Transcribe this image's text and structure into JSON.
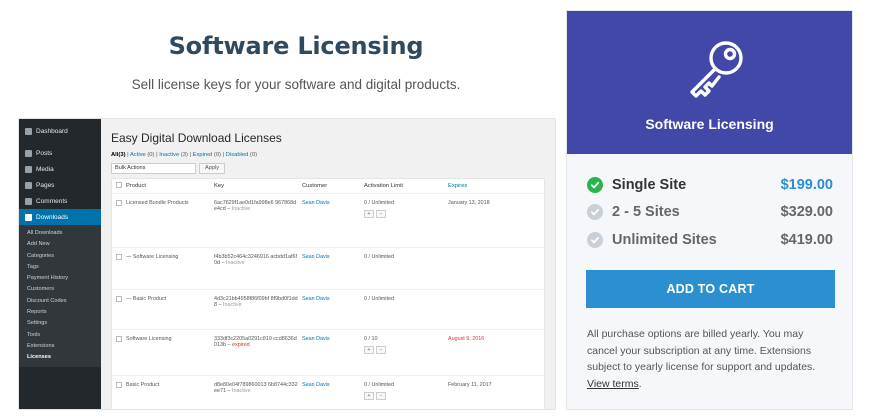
{
  "hero": {
    "title": "Software Licensing",
    "subtitle": "Sell license keys for your software and digital products."
  },
  "admin": {
    "sidebar_top": [
      "Dashboard",
      "Posts",
      "Media",
      "Pages",
      "Comments",
      "Downloads"
    ],
    "sidebar_sub": [
      "All Downloads",
      "Add New",
      "Categories",
      "Tags",
      "Payment History",
      "Customers",
      "Discount Codes",
      "Reports",
      "Settings",
      "Tools",
      "Extensions",
      "Licenses"
    ],
    "page_title": "Easy Digital Download Licenses",
    "filters": {
      "all": "All",
      "all_count": "(3)",
      "active": "Active",
      "active_count": "(0)",
      "inactive": "Inactive",
      "inactive_count": "(3)",
      "expired": "Expired",
      "expired_count": "(0)",
      "disabled": "Disabled",
      "disabled_count": "(0)"
    },
    "bulk_actions": "Bulk Actions",
    "apply": "Apply",
    "columns": [
      "Product",
      "Key",
      "Customer",
      "Activation Limit",
      "Expires"
    ],
    "rows": [
      {
        "product": "Licensed Bundle Products",
        "key": "6ac7629f1ae0d1fa998e6 967868de4cd",
        "status": "Inactive",
        "customer": "Sean Davis",
        "limit": "0 / Unlimited",
        "expires": "January 13, 2018",
        "has_buttons": true
      },
      {
        "product": "— Software Licensing",
        "key": "f4b3b52c464c3246916 acbdd1af6f0d",
        "status": "Inactive",
        "customer": "Sean Davis",
        "limit": "0 / Unlimited",
        "expires": "",
        "has_buttons": false
      },
      {
        "product": "— Basic Product",
        "key": "4d3c21bb4958f86f09bf 8f9bd0f1dd8",
        "status": "Inactive",
        "customer": "Sean Davis",
        "limit": "0 / Unlimited",
        "expires": "",
        "has_buttons": false
      },
      {
        "product": "Software Licensing",
        "key": "333df3c2205a0291c819 ccd8636d013b",
        "status": "expired",
        "customer": "Sean Davis",
        "limit": "0 / 10",
        "expires": "August 9, 2016",
        "has_buttons": true
      },
      {
        "product": "Basic Product",
        "key": "d8e80e04f789860013 6b8744c332ee71",
        "status": "Inactive",
        "customer": "Sean Davis",
        "limit": "0 / Unlimited",
        "expires": "February 11, 2017",
        "has_buttons": true
      }
    ]
  },
  "card": {
    "name": "Software Licensing",
    "header_color": "#4148a8",
    "options": [
      {
        "label": "Single Site",
        "price": "$199.00",
        "selected": true
      },
      {
        "label": "2 - 5 Sites",
        "price": "$329.00",
        "selected": false
      },
      {
        "label": "Unlimited Sites",
        "price": "$419.00",
        "selected": false
      }
    ],
    "cta": "ADD TO CART",
    "fine_print": "All purchase options are billed yearly. You may cancel your subscription at any time. Extensions subject to yearly license for support and updates.",
    "view_terms": "View terms",
    "view_terms_suffix": "."
  }
}
